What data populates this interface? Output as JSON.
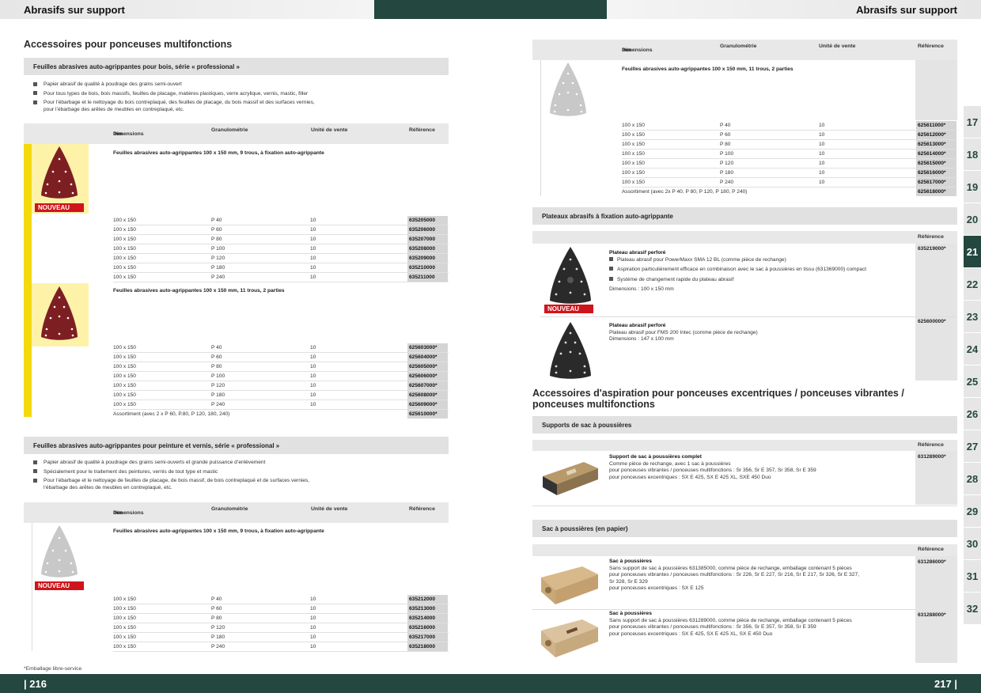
{
  "header": {
    "left_title": "Abrasifs sur support",
    "right_title": "Abrasifs sur support"
  },
  "footer": {
    "left_page": "| 216",
    "right_page": "217 |",
    "note": "*Emballage libre-service"
  },
  "tabs": [
    "17",
    "18",
    "19",
    "20",
    "21",
    "22",
    "23",
    "24",
    "25",
    "26",
    "27",
    "28",
    "29",
    "30",
    "31",
    "32"
  ],
  "active_tab": "21",
  "cols": {
    "dim": "Dimensions",
    "mm": "mm",
    "grain": "Granulométrie",
    "unit": "Unité de vente",
    "ref": "Référence"
  },
  "badge": "NOUVEAU",
  "left": {
    "title": "Accessoires pour ponceuses multifonctions",
    "s1": {
      "bar": "Feuilles abrasives auto-agrippantes pour bois, série « professional »",
      "bullets": [
        "Papier abrasif de qualité à poudrage des grains semi-ouvert",
        "Pour tous types de bois, bois massifs, feuilles de placage, matières plastiques, verre acrylique, vernis, mastic, filler",
        "Pour l’ébarbage et le nettoyage du bois contreplaqué, des feuilles de placage, du bois massif et des surfaces vernies,",
        "pour l’ébarbage des arêtes de meubles en contreplaqué, etc."
      ],
      "p1": "Feuilles abrasives auto-agrippantes 100 x 150 mm, 9 trous, à fixation auto-agrippante",
      "rows1": [
        [
          "100 x 150",
          "P 40",
          "10",
          "635205000"
        ],
        [
          "100 x 150",
          "P 60",
          "10",
          "635206000"
        ],
        [
          "100 x 150",
          "P 80",
          "10",
          "635207000"
        ],
        [
          "100 x 150",
          "P 100",
          "10",
          "635208000"
        ],
        [
          "100 x 150",
          "P 120",
          "10",
          "635209000"
        ],
        [
          "100 x 150",
          "P 180",
          "10",
          "635210000"
        ],
        [
          "100 x 150",
          "P 240",
          "10",
          "635211000"
        ]
      ],
      "p2": "Feuilles abrasives auto-agrippantes 100 x 150 mm, 11 trous, 2 parties",
      "rows2": [
        [
          "100 x 150",
          "P 40",
          "10",
          "625603000*"
        ],
        [
          "100 x 150",
          "P 60",
          "10",
          "625604000*"
        ],
        [
          "100 x 150",
          "P 80",
          "10",
          "625605000*"
        ],
        [
          "100 x 150",
          "P 100",
          "10",
          "625606000*"
        ],
        [
          "100 x 150",
          "P 120",
          "10",
          "625607000*"
        ],
        [
          "100 x 150",
          "P 180",
          "10",
          "625608000*"
        ],
        [
          "100 x 150",
          "P 240",
          "10",
          "625609000*"
        ]
      ],
      "assort": "Assortiment (avec 2 x P 60, P.80, P 120, 180, 240)",
      "assort_ref": "625610000*"
    },
    "s2": {
      "bar": "Feuilles abrasives auto-agrippantes pour peinture et vernis, série « professional »",
      "bullets": [
        "Papier abrasif de qualité à poudrage des grains semi-ouverts et grande puissance d’enlèvement",
        "Spécialement pour le traitement des peintures, vernis de tout type et mastic",
        "Pour l’ébarbage et le nettoyage de feuilles de placage, de bois massif, de bois contreplaqué et de surfaces vernies,",
        "l’ébarbage des arêtes de meubles en contreplaqué, etc."
      ],
      "p1": "Feuilles abrasives auto-agrippantes 100 x 150 mm, 9 trous, à fixation auto-agrippante",
      "rows": [
        [
          "100 x 150",
          "P 40",
          "10",
          "635212000"
        ],
        [
          "100 x 150",
          "P 60",
          "10",
          "635213000"
        ],
        [
          "100 x 150",
          "P 80",
          "10",
          "635214000"
        ],
        [
          "100 x 150",
          "P 120",
          "10",
          "635216000"
        ],
        [
          "100 x 150",
          "P 180",
          "10",
          "635217000"
        ],
        [
          "100 x 150",
          "P 240",
          "10",
          "635218000"
        ]
      ]
    }
  },
  "right": {
    "p1": "Feuilles abrasives auto-agrippantes 100 x 150 mm, 11 trous, 2 parties",
    "rows": [
      [
        "100 x 150",
        "P 40",
        "10",
        "625611000*"
      ],
      [
        "100 x 150",
        "P 60",
        "10",
        "625612000*"
      ],
      [
        "100 x 150",
        "P 80",
        "10",
        "625613000*"
      ],
      [
        "100 x 150",
        "P 100",
        "10",
        "625614000*"
      ],
      [
        "100 x 150",
        "P 120",
        "10",
        "625615000*"
      ],
      [
        "100 x 150",
        "P 180",
        "10",
        "625616000*"
      ],
      [
        "100 x 150",
        "P 240",
        "10",
        "625617000*"
      ]
    ],
    "assort": "Assortiment (avec 2x P 40, P 80, P 120, P 180, P 240)",
    "assort_ref": "625618000*",
    "plates_bar": "Plateaux abrasifs à fixation auto-agrippante",
    "plate1": {
      "name": "Plateau abrasif perforé",
      "b": [
        "Plateau abrasif pour PowerMaxx SMA 12 BL (comme pièce de rechange)",
        "Aspiration particulièrement efficace en combinaison avec le sac à poussières en tissu (631369000) compact",
        "Système de changement rapide du plateau abrasif"
      ],
      "dim": "Dimensions : 100 x 150 mm",
      "ref": "635219000*"
    },
    "plate2": {
      "name": "Plateau abrasif perforé",
      "l1": "Plateau abrasif pour FMS 200 Intec (comme pièce de rechange)",
      "l2": "Dimensions : 147 x 100 mm",
      "ref": "625600000*"
    },
    "title2a": "Accessoires d'aspiration pour ponceuses excentriques / ponceuses vibrantes /",
    "title2b": "ponceuses multifonctions",
    "support_bar": "Supports de sac à poussières",
    "support": {
      "name": "Support de sac à poussières complet",
      "l1": "Comme pièce de rechange, avec 1 sac à poussières",
      "l2": "pour ponceuses vibrantes / ponceuses multifonctions : Sr 356, Sr E 357, Sr 358, Sr E 359",
      "l3": "pour ponceuses excentriques : SX E 425, SX E 425 XL, SXE 450 Duo",
      "ref": "631289000*"
    },
    "bag_bar": "Sac à poussières (en papier)",
    "bag1": {
      "name": "Sac à poussières",
      "l1": "Sans support de sac à poussières 631385000, comme pièce de rechange, emballage contenant 5 pièces",
      "l2": "pour ponceuses vibrantes / ponceuses multifonctions : Sr 226, Sr E 227, Sr 216, Sr E 217, Sr 326, Sr E 327,",
      "l3": "Sr 328, Sr E 329",
      "l4": "pour ponceuses excentriques : SX E 125",
      "ref": "631286000*"
    },
    "bag2": {
      "name": "Sac à poussières",
      "l1": "Sans support de sac à poussières 631289000, comme pièce de rechange, emballage contenant 5 pièces",
      "l2": "pour ponceuses vibrantes / ponceuses multifonctions : Sr 356, Sr E 357, Sr 358, Sr E 359",
      "l3": "pour ponceuses excentriques : SX E 425, SX E 425 XL, SX E 450 Duo",
      "ref": "631288000*"
    }
  }
}
